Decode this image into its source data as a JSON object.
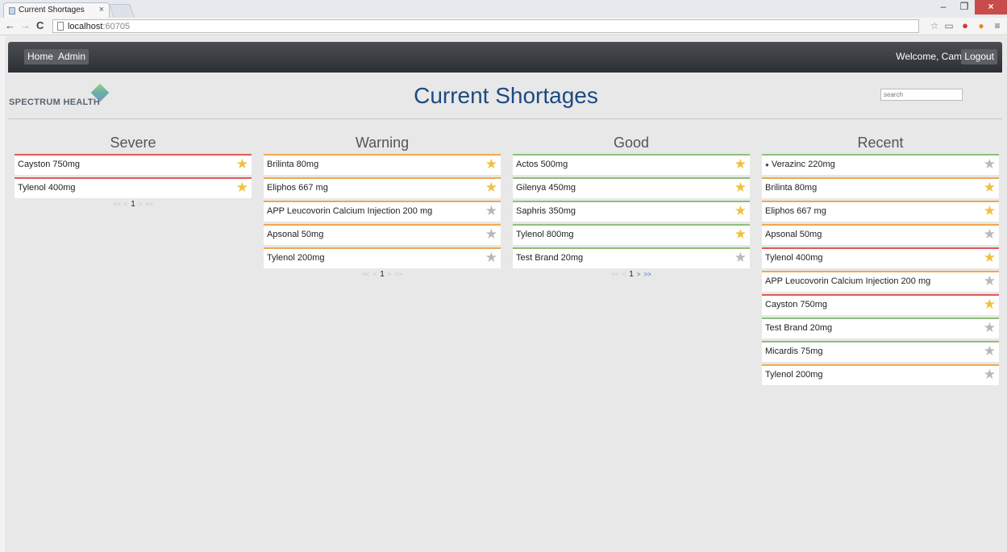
{
  "browser": {
    "tab_title": "Current Shortages",
    "tab_close": "×",
    "url_host": "localhost",
    "url_port": ":60705",
    "back": "←",
    "forward": "→",
    "reload": "C",
    "win_min": "–",
    "win_restore": "❐",
    "win_close": "×"
  },
  "nav": {
    "home": "Home",
    "admin": "Admin",
    "welcome": "Welcome, Cam",
    "logout": "Logout"
  },
  "logo": "SPECTRUM HEALTH",
  "title": "Current Shortages",
  "search": {
    "placeholder": "search"
  },
  "columns": [
    {
      "title": "Severe",
      "items": [
        {
          "name": "Cayston 750mg",
          "color": "red",
          "starred": true
        },
        {
          "name": "Tylenol 400mg",
          "color": "red",
          "starred": true
        }
      ],
      "pager": {
        "first": "<<",
        "prev": "<",
        "page": "1",
        "next": ">",
        "last": ">>"
      }
    },
    {
      "title": "Warning",
      "items": [
        {
          "name": "Brilinta 80mg",
          "color": "orange",
          "starred": true
        },
        {
          "name": "Eliphos 667 mg",
          "color": "orange",
          "starred": true
        },
        {
          "name": "APP Leucovorin Calcium Injection 200 mg",
          "color": "orange",
          "starred": false
        },
        {
          "name": "Apsonal 50mg",
          "color": "orange",
          "starred": false
        },
        {
          "name": "Tylenol 200mg",
          "color": "orange",
          "starred": false
        }
      ],
      "pager": {
        "first": "<<",
        "prev": "<",
        "page": "1",
        "next": ">",
        "last": ">>"
      }
    },
    {
      "title": "Good",
      "items": [
        {
          "name": "Actos 500mg",
          "color": "green",
          "starred": true
        },
        {
          "name": "Gilenya 450mg",
          "color": "green",
          "starred": true
        },
        {
          "name": "Saphris 350mg",
          "color": "green",
          "starred": true
        },
        {
          "name": "Tylenol 800mg",
          "color": "green",
          "starred": true
        },
        {
          "name": "Test Brand 20mg",
          "color": "green",
          "starred": false
        }
      ],
      "pager": {
        "first": "<<",
        "prev": "<",
        "page": "1",
        "next": ">",
        "last": ">>"
      }
    },
    {
      "title": "Recent",
      "items": [
        {
          "name": "Verazinc 220mg",
          "color": "green",
          "starred": false,
          "dot": true
        },
        {
          "name": "Brilinta 80mg",
          "color": "orange",
          "starred": true
        },
        {
          "name": "Eliphos 667 mg",
          "color": "orange",
          "starred": true
        },
        {
          "name": "Apsonal 50mg",
          "color": "orange",
          "starred": false
        },
        {
          "name": "Tylenol 400mg",
          "color": "red",
          "starred": true
        },
        {
          "name": "APP Leucovorin Calcium Injection 200 mg",
          "color": "orange",
          "starred": false
        },
        {
          "name": "Cayston 750mg",
          "color": "red",
          "starred": true
        },
        {
          "name": "Test Brand 20mg",
          "color": "green",
          "starred": false
        },
        {
          "name": "Micardis 75mg",
          "color": "green",
          "starred": false
        },
        {
          "name": "Tylenol 200mg",
          "color": "orange",
          "starred": false
        }
      ]
    }
  ],
  "colors": {
    "red": "#e05a5a",
    "orange": "#f0a850",
    "green": "#8fbf7a",
    "star_gold": "#f0c040",
    "star_grey": "#b8b8b8",
    "title": "#1d4a82"
  }
}
